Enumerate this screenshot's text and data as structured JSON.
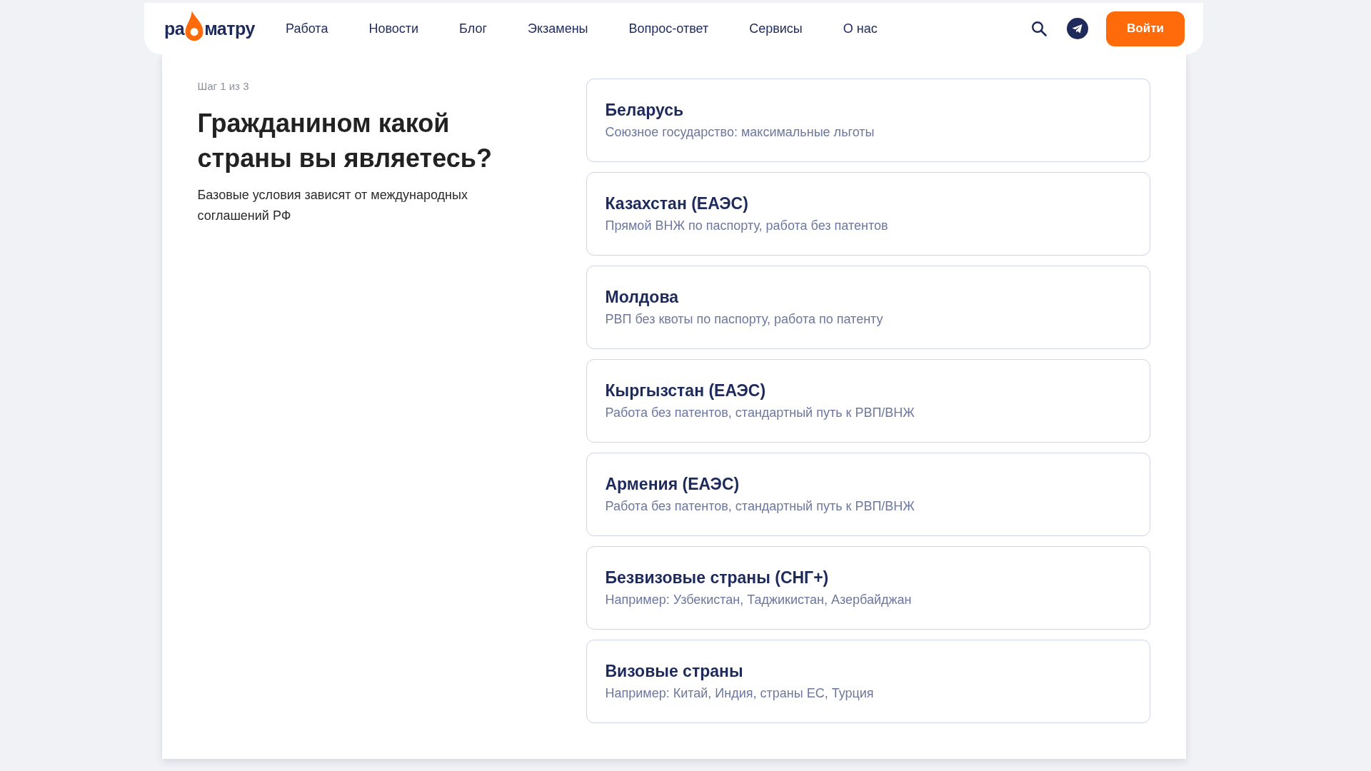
{
  "header": {
    "logo": {
      "text_before": "ра",
      "text_after": "матру"
    },
    "nav": [
      "Работа",
      "Новости",
      "Блог",
      "Экзамены",
      "Вопрос-ответ",
      "Сервисы",
      "О нас"
    ],
    "login_button": "Войти"
  },
  "intro": {
    "step": "Шаг 1 из 3",
    "title": "Гражданином какой страны вы являетесь?",
    "description": "Базовые условия зависят от международных соглашений РФ"
  },
  "options": [
    {
      "title": "Беларусь",
      "subtitle": "Союзное государство: максимальные льготы"
    },
    {
      "title": "Казахстан (ЕАЭС)",
      "subtitle": "Прямой ВНЖ по паспорту, работа без патентов"
    },
    {
      "title": "Молдова",
      "subtitle": "РВП без квоты по паспорту, работа по патенту"
    },
    {
      "title": "Кыргызстан (ЕАЭС)",
      "subtitle": "Работа без патентов, стандартный путь к РВП/ВНЖ"
    },
    {
      "title": "Армения (ЕАЭС)",
      "subtitle": "Работа без патентов, стандартный путь к РВП/ВНЖ"
    },
    {
      "title": "Безвизовые страны (СНГ+)",
      "subtitle": "Например: Узбекистан, Таджикистан, Азербайджан"
    },
    {
      "title": "Визовые страны",
      "subtitle": "Например: Китай, Индия, страны ЕС, Турция"
    }
  ]
}
